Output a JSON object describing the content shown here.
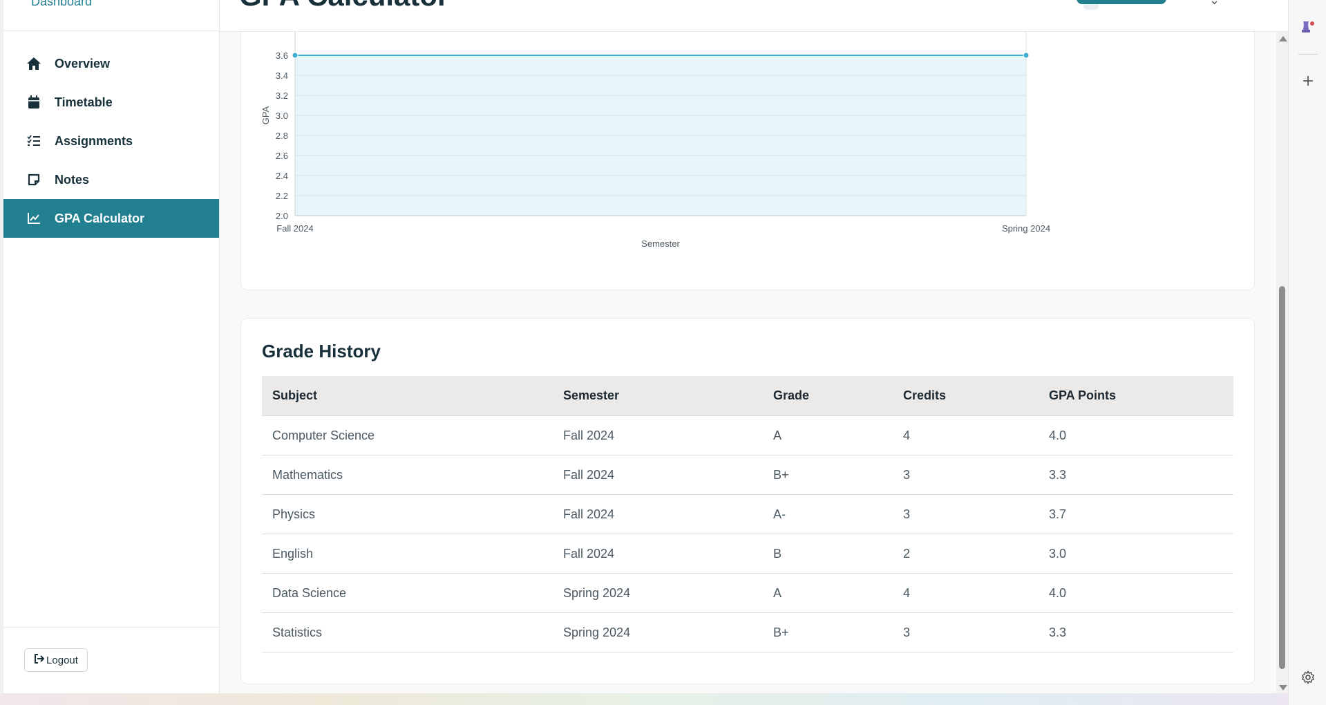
{
  "sidebar": {
    "dashboard_link": "Dashboard",
    "items": [
      {
        "label": "Overview",
        "icon": "home-icon",
        "active": false
      },
      {
        "label": "Timetable",
        "icon": "calendar-icon",
        "active": false
      },
      {
        "label": "Assignments",
        "icon": "checklist-icon",
        "active": false
      },
      {
        "label": "Notes",
        "icon": "note-icon",
        "active": false
      },
      {
        "label": "GPA Calculator",
        "icon": "chart-line-icon",
        "active": true
      }
    ],
    "logout_label": "Logout"
  },
  "header": {
    "title": "GPA Calculator"
  },
  "colors": {
    "accent": "#217f8f",
    "chart_fill": "#e7f6f8",
    "chart_line": "#3aaed0"
  },
  "chart_data": {
    "type": "area",
    "categories": [
      "Fall 2024",
      "Spring 2024"
    ],
    "series": [
      {
        "values": [
          3.6,
          3.6
        ]
      }
    ],
    "xlabel": "Semester",
    "ylabel": "GPA",
    "yticks": [
      "2.0",
      "2.2",
      "2.4",
      "2.6",
      "2.8",
      "3.0",
      "3.2",
      "3.4",
      "3.6"
    ],
    "ylim": [
      2.0,
      3.6
    ],
    "grid": true
  },
  "grade_history": {
    "title": "Grade History",
    "columns": [
      "Subject",
      "Semester",
      "Grade",
      "Credits",
      "GPA Points"
    ],
    "rows": [
      [
        "Computer Science",
        "Fall 2024",
        "A",
        "4",
        "4.0"
      ],
      [
        "Mathematics",
        "Fall 2024",
        "B+",
        "3",
        "3.3"
      ],
      [
        "Physics",
        "Fall 2024",
        "A-",
        "3",
        "3.7"
      ],
      [
        "English",
        "Fall 2024",
        "B",
        "2",
        "3.0"
      ],
      [
        "Data Science",
        "Spring 2024",
        "A",
        "4",
        "4.0"
      ],
      [
        "Statistics",
        "Spring 2024",
        "B+",
        "3",
        "3.3"
      ]
    ]
  }
}
